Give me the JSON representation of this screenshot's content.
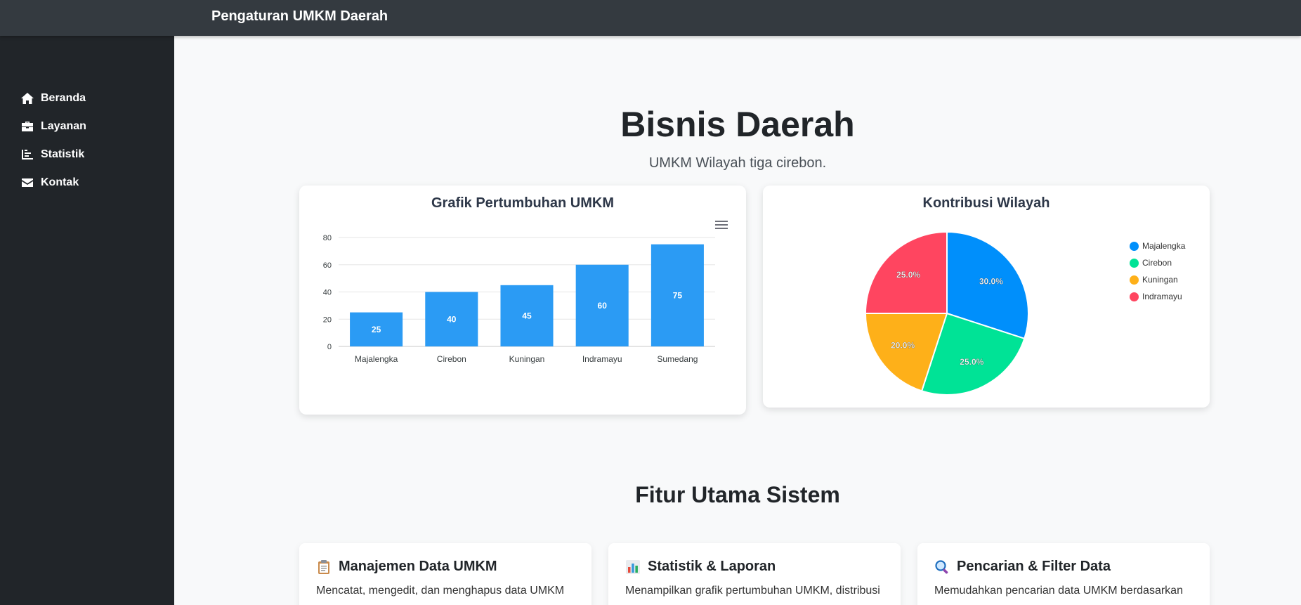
{
  "brand": "Pengaturan UMKM Daerah",
  "sidebar": {
    "items": [
      {
        "label": "Beranda",
        "icon": "home-icon"
      },
      {
        "label": "Layanan",
        "icon": "briefcase-icon"
      },
      {
        "label": "Statistik",
        "icon": "chart-icon"
      },
      {
        "label": "Kontak",
        "icon": "envelope-icon"
      }
    ]
  },
  "hero": {
    "title": "Bisnis Daerah",
    "subtitle": "UMKM Wilayah tiga cirebon."
  },
  "charts": {
    "bar_title": "Grafik Pertumbuhan UMKM",
    "pie_title": "Kontribusi Wilayah"
  },
  "colors": {
    "bar": "#2b9bf4",
    "pie": [
      "#008ffb",
      "#00e396",
      "#feb019",
      "#ff4560"
    ]
  },
  "chart_data": [
    {
      "type": "bar",
      "title": "Grafik Pertumbuhan UMKM",
      "categories": [
        "Majalengka",
        "Cirebon",
        "Kuningan",
        "Indramayu",
        "Sumedang"
      ],
      "values": [
        25,
        40,
        45,
        60,
        75
      ],
      "yticks": [
        "0",
        "20",
        "40",
        "60",
        "80"
      ],
      "ylim": [
        0,
        80
      ],
      "grid": true,
      "data_labels": true
    },
    {
      "type": "pie",
      "title": "Kontribusi Wilayah",
      "categories": [
        "Majalengka",
        "Cirebon",
        "Kuningan",
        "Indramayu"
      ],
      "values": [
        30,
        25,
        20,
        25
      ],
      "labels": [
        "30.0%",
        "25.0%",
        "20.0%",
        "25.0%"
      ],
      "legend": "right"
    }
  ],
  "features_section": {
    "title": "Fitur Utama Sistem",
    "items": [
      {
        "icon": "clipboard-icon",
        "title": "Manajemen Data UMKM",
        "text": "Mencatat, mengedit, dan menghapus data UMKM"
      },
      {
        "icon": "bar-chart-icon",
        "title": "Statistik & Laporan",
        "text": "Menampilkan grafik pertumbuhan UMKM, distribusi"
      },
      {
        "icon": "magnifier-icon",
        "title": "Pencarian & Filter Data",
        "text": "Memudahkan pencarian data UMKM berdasarkan"
      }
    ]
  }
}
